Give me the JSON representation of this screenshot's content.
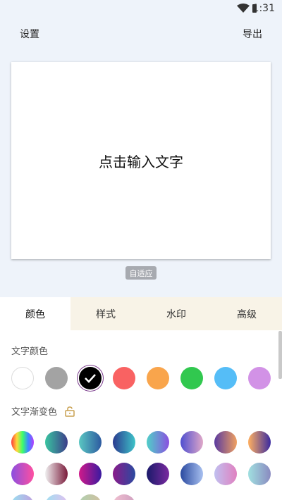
{
  "status": {
    "time": "1:31"
  },
  "header": {
    "settings_label": "设置",
    "export_label": "导出"
  },
  "canvas": {
    "placeholder": "点击输入文字",
    "adapt_label": "自适应"
  },
  "tabs": [
    {
      "label": "颜色",
      "active": true
    },
    {
      "label": "样式",
      "active": false
    },
    {
      "label": "水印",
      "active": false
    },
    {
      "label": "高级",
      "active": false
    }
  ],
  "text_color": {
    "title": "文字颜色",
    "colors": [
      "#ffffff",
      "#a3a3a3",
      "#000000",
      "#f96262",
      "#f9a54c",
      "#31c84f",
      "#55bdf7",
      "#d292e6"
    ],
    "selected_index": 2
  },
  "gradient": {
    "title": "文字渐变色",
    "rows": [
      [
        [
          "#ff3b3b",
          "#ffd93b",
          "#3bff6a",
          "#3b8bff",
          "#b53bff"
        ],
        [
          "#39c5a0",
          "#3d3d8a"
        ],
        [
          "#5ac7c2",
          "#2d5aa0"
        ],
        [
          "#2a3a8f",
          "#3ec4c9"
        ],
        [
          "#4fd0c8",
          "#8a4fe0"
        ],
        [
          "#4f4fd0",
          "#e0a8c8"
        ],
        [
          "#5a3aa0",
          "#f0a060"
        ],
        [
          "#ffb060",
          "#3a2aa0"
        ]
      ],
      [
        [
          "#8a4fe0",
          "#ff4fa0"
        ],
        [
          "#f0f0f0",
          "#7a1a3a"
        ],
        [
          "#d01a8a",
          "#3a1aa0"
        ],
        [
          "#8a1a8a",
          "#2a4aa0"
        ],
        [
          "#1a1a6a",
          "#7a2aa0"
        ],
        [
          "#2a4aa0",
          "#a8c0f0"
        ],
        [
          "#c0c0f0",
          "#e080c0"
        ],
        [
          "#a0e0e0",
          "#8a8ac0"
        ]
      ]
    ]
  }
}
